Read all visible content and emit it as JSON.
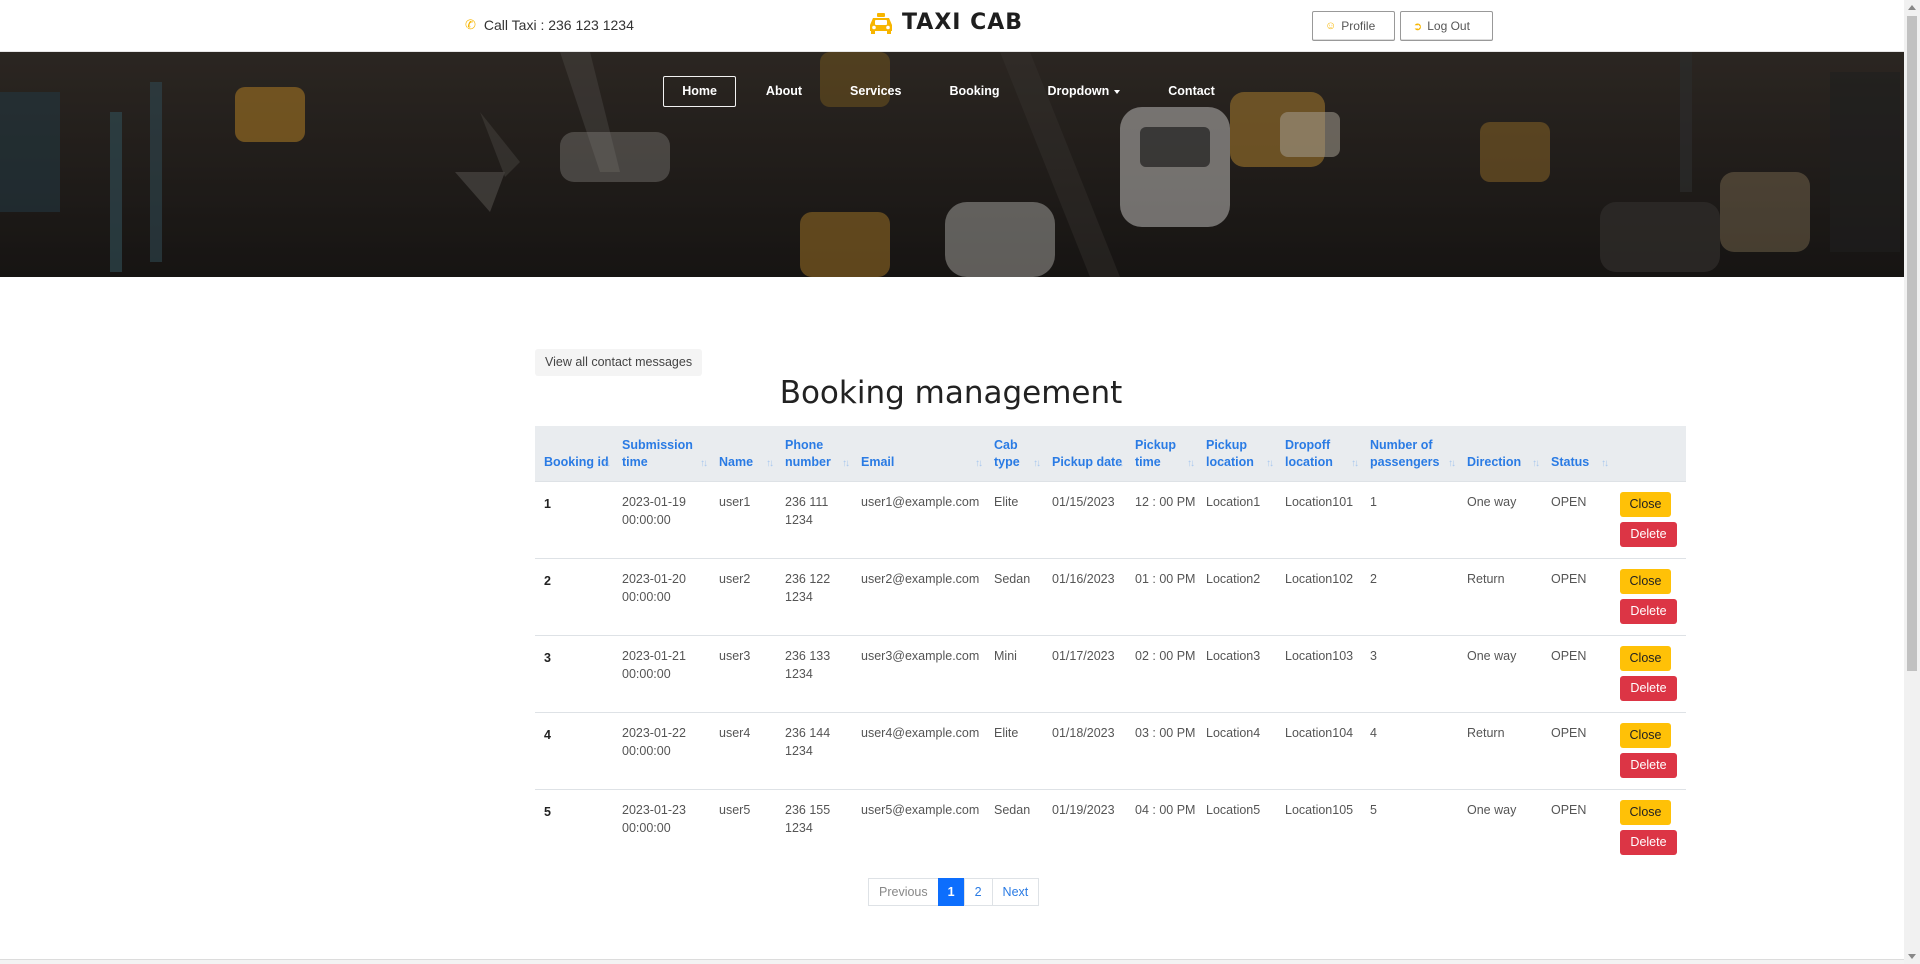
{
  "header": {
    "phone_text": "Call Taxi : 236 123 1234",
    "brand": "TAXI CAB",
    "profile_label": "Profile",
    "logout_label": "Log Out"
  },
  "nav": {
    "items": [
      {
        "label": "Home",
        "active": true
      },
      {
        "label": "About"
      },
      {
        "label": "Services"
      },
      {
        "label": "Booking"
      },
      {
        "label": "Dropdown",
        "has_caret": true
      },
      {
        "label": "Contact"
      }
    ]
  },
  "main": {
    "view_messages_label": "View all contact messages",
    "title": "Booking management",
    "table": {
      "columns": [
        "Booking id",
        "Submission time",
        "Name",
        "Phone number",
        "Email",
        "Cab type",
        "Pickup date",
        "Pickup time",
        "Pickup location",
        "Dropoff location",
        "Number of passengers",
        "Direction",
        "Status"
      ],
      "rows": [
        {
          "id": "1",
          "submission": "2023-01-19 00:00:00",
          "name": "user1",
          "phone": "236 111 1234",
          "email": "user1@example.com",
          "cab": "Elite",
          "date": "01/15/2023",
          "time": "12 : 00 PM",
          "pickup": "Location1",
          "dropoff": "Location101",
          "passengers": "1",
          "direction": "One way",
          "status": "OPEN"
        },
        {
          "id": "2",
          "submission": "2023-01-20 00:00:00",
          "name": "user2",
          "phone": "236 122 1234",
          "email": "user2@example.com",
          "cab": "Sedan",
          "date": "01/16/2023",
          "time": "01 : 00 PM",
          "pickup": "Location2",
          "dropoff": "Location102",
          "passengers": "2",
          "direction": "Return",
          "status": "OPEN"
        },
        {
          "id": "3",
          "submission": "2023-01-21 00:00:00",
          "name": "user3",
          "phone": "236 133 1234",
          "email": "user3@example.com",
          "cab": "Mini",
          "date": "01/17/2023",
          "time": "02 : 00 PM",
          "pickup": "Location3",
          "dropoff": "Location103",
          "passengers": "3",
          "direction": "One way",
          "status": "OPEN"
        },
        {
          "id": "4",
          "submission": "2023-01-22 00:00:00",
          "name": "user4",
          "phone": "236 144 1234",
          "email": "user4@example.com",
          "cab": "Elite",
          "date": "01/18/2023",
          "time": "03 : 00 PM",
          "pickup": "Location4",
          "dropoff": "Location104",
          "passengers": "4",
          "direction": "Return",
          "status": "OPEN"
        },
        {
          "id": "5",
          "submission": "2023-01-23 00:00:00",
          "name": "user5",
          "phone": "236 155 1234",
          "email": "user5@example.com",
          "cab": "Sedan",
          "date": "01/19/2023",
          "time": "04 : 00 PM",
          "pickup": "Location5",
          "dropoff": "Location105",
          "passengers": "5",
          "direction": "One way",
          "status": "OPEN"
        }
      ],
      "close_label": "Close",
      "delete_label": "Delete"
    },
    "pagination": {
      "previous": "Previous",
      "pages": [
        "1",
        "2"
      ],
      "current": "1",
      "next": "Next"
    }
  },
  "colors": {
    "accent_yellow": "#ffc107",
    "danger_red": "#dc3545",
    "link_blue": "#2a7be4",
    "brand_icon": "#f7b500"
  },
  "icons": {
    "phone": "phone-icon",
    "brand": "taxi-icon",
    "profile": "user-circle-icon",
    "logout": "sign-out-icon",
    "sort": "sort-icon"
  }
}
